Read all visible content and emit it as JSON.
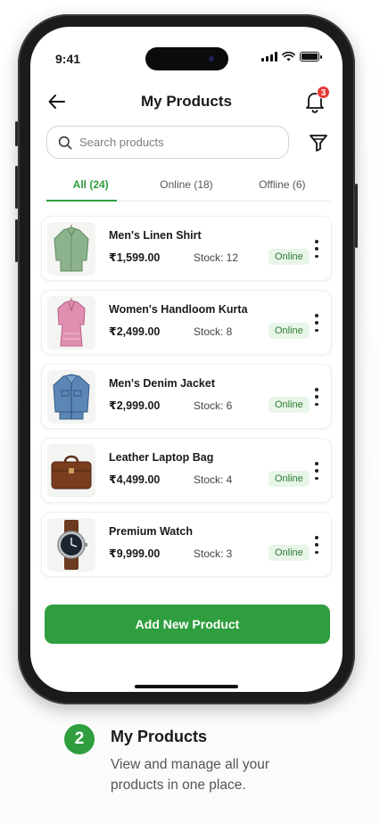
{
  "status_bar": {
    "time": "9:41"
  },
  "header": {
    "title": "My Products",
    "notification_count": "3"
  },
  "search": {
    "placeholder": "Search products",
    "value": ""
  },
  "tabs": [
    {
      "label": "All (24)",
      "active": true
    },
    {
      "label": "Online (18)",
      "active": false
    },
    {
      "label": "Offline (6)",
      "active": false
    }
  ],
  "products": [
    {
      "name": "Men's Linen Shirt",
      "price": "₹1,599.00",
      "stock": "Stock: 12",
      "status": "Online",
      "icon": "shirt-icon"
    },
    {
      "name": "Women's Handloom Kurta",
      "price": "₹2,499.00",
      "stock": "Stock: 8",
      "status": "Online",
      "icon": "kurta-icon"
    },
    {
      "name": "Men's Denim Jacket",
      "price": "₹2,999.00",
      "stock": "Stock: 6",
      "status": "Online",
      "icon": "jacket-icon"
    },
    {
      "name": "Leather Laptop Bag",
      "price": "₹4,499.00",
      "stock": "Stock: 4",
      "status": "Online",
      "icon": "bag-icon"
    },
    {
      "name": "Premium Watch",
      "price": "₹9,999.00",
      "stock": "Stock: 3",
      "status": "Online",
      "icon": "watch-icon"
    }
  ],
  "actions": {
    "add_label": "Add New Product"
  },
  "caption": {
    "step": "2",
    "title": "My Products",
    "description": "View and manage all your products in one place."
  },
  "colors": {
    "accent": "#2e9e3e",
    "badge": "#e53935",
    "status_bg": "#e8f5e9",
    "status_text": "#2e7d32"
  }
}
